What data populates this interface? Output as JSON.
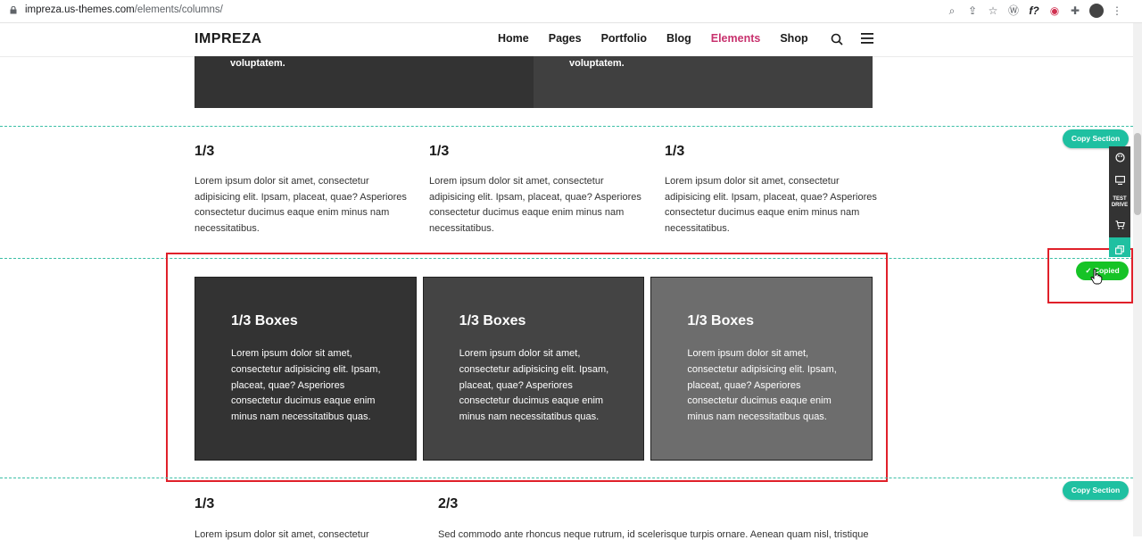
{
  "browser": {
    "domain": "impreza.us-themes.com",
    "path": "/elements/columns/"
  },
  "header": {
    "logo": "IMPREZA",
    "nav": [
      "Home",
      "Pages",
      "Portfolio",
      "Blog",
      "Elements",
      "Shop"
    ],
    "active_nav": "Elements"
  },
  "top_section": {
    "left_text": "voluptatem.",
    "right_text": "voluptatem.",
    "colors": [
      "#333333",
      "#404040"
    ]
  },
  "thirds": [
    {
      "title": "1/3",
      "body": "Lorem ipsum dolor sit amet, consectetur adipisicing elit. Ipsam, placeat, quae? Asperiores consectetur ducimus eaque enim minus nam necessitatibus."
    },
    {
      "title": "1/3",
      "body": "Lorem ipsum dolor sit amet, consectetur adipisicing elit. Ipsam, placeat, quae? Asperiores consectetur ducimus eaque enim minus nam necessitatibus."
    },
    {
      "title": "1/3",
      "body": "Lorem ipsum dolor sit amet, consectetur adipisicing elit. Ipsam, placeat, quae? Asperiores consectetur ducimus eaque enim minus nam necessitatibus."
    }
  ],
  "boxes": [
    {
      "title": "1/3 Boxes",
      "body": "Lorem ipsum dolor sit amet, consectetur adipisicing elit. Ipsam, placeat, quae? Asperiores consectetur ducimus eaque enim minus nam necessitatibus quas.",
      "color": "#333333"
    },
    {
      "title": "1/3 Boxes",
      "body": "Lorem ipsum dolor sit amet, consectetur adipisicing elit. Ipsam, placeat, quae? Asperiores consectetur ducimus eaque enim minus nam necessitatibus quas.",
      "color": "#444444"
    },
    {
      "title": "1/3 Boxes",
      "body": "Lorem ipsum dolor sit amet, consectetur adipisicing elit. Ipsam, placeat, quae? Asperiores consectetur ducimus eaque enim minus nam necessitatibus quas.",
      "color": "#6d6d6d"
    }
  ],
  "copy_section_label": "Copy Section",
  "copied_label": "✓ Copied",
  "sidetool": {
    "test_drive_1": "TEST",
    "test_drive_2": "DRIVE"
  },
  "bottom": {
    "left_title": "1/3",
    "right_title": "2/3",
    "left_text": "Lorem ipsum dolor sit amet, consectetur",
    "right_text": "Sed commodo ante rhoncus neque rutrum, id scelerisque turpis ornare. Aenean quam nisl, tristique"
  },
  "accent_colors": {
    "teal": "#1fc0a1",
    "green": "#16c326",
    "pink": "#c8326e",
    "red_highlight": "#e0202a"
  }
}
